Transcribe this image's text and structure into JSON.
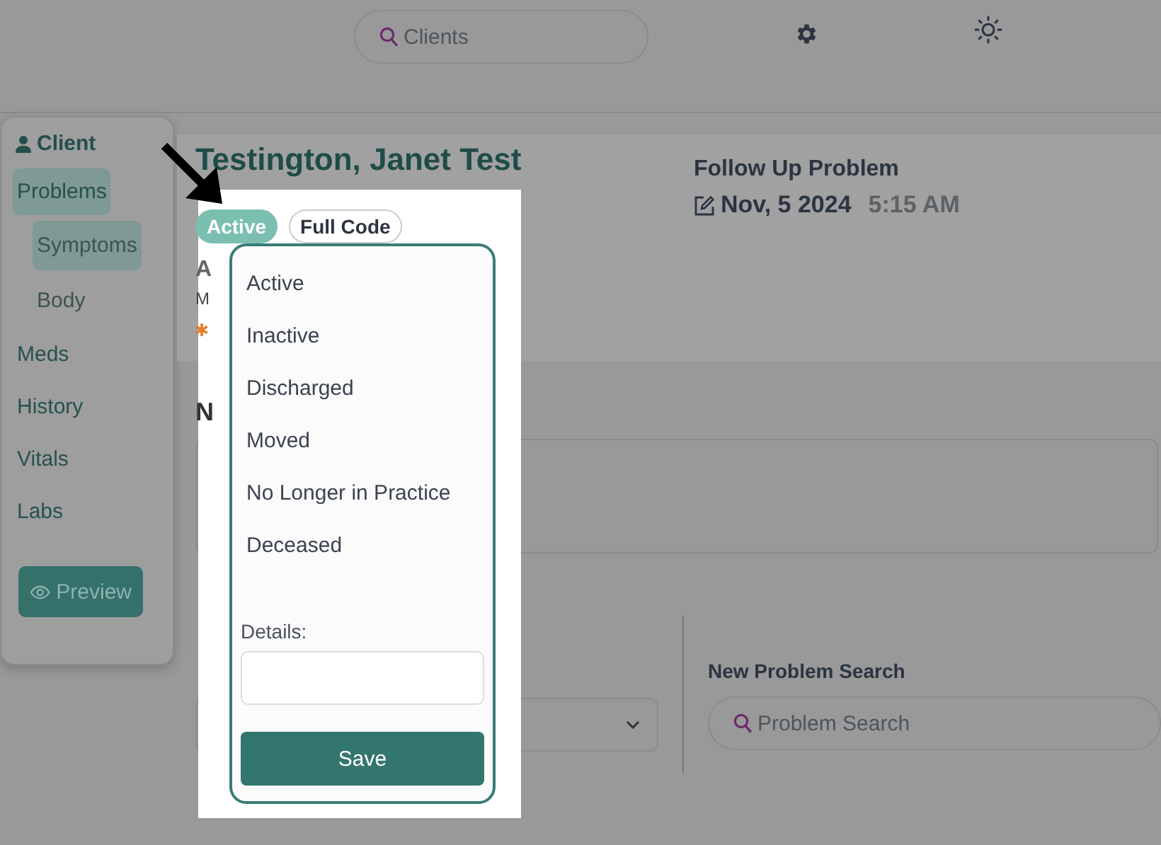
{
  "header": {
    "search": {
      "placeholder": "Clients"
    }
  },
  "sidebar": {
    "title": "Client",
    "items": [
      {
        "label": "Problems",
        "selected": true,
        "children": [
          {
            "label": "Symptoms",
            "selected": true
          },
          {
            "label": "Body",
            "selected": false
          }
        ]
      },
      {
        "label": "Meds",
        "selected": false
      },
      {
        "label": "History",
        "selected": false
      },
      {
        "label": "Vitals",
        "selected": false
      },
      {
        "label": "Labs",
        "selected": false
      }
    ],
    "preview_button": "Preview"
  },
  "patient": {
    "name": "Testington, Janet Test",
    "status_badge": "Active",
    "code_badge": "Full Code",
    "partial_heading": "A",
    "partial_line": "M",
    "section_heading": "N"
  },
  "visit": {
    "title": "Follow Up Problem",
    "date": "Nov, 5 2024",
    "time": "5:15 AM"
  },
  "problem_search": {
    "label": "New Problem Search",
    "placeholder": "Problem Search"
  },
  "status_menu": {
    "options": [
      "Active",
      "Inactive",
      "Discharged",
      "Moved",
      "No Longer in Practice",
      "Deceased"
    ],
    "details_label": "Details:",
    "save_button": "Save"
  }
}
